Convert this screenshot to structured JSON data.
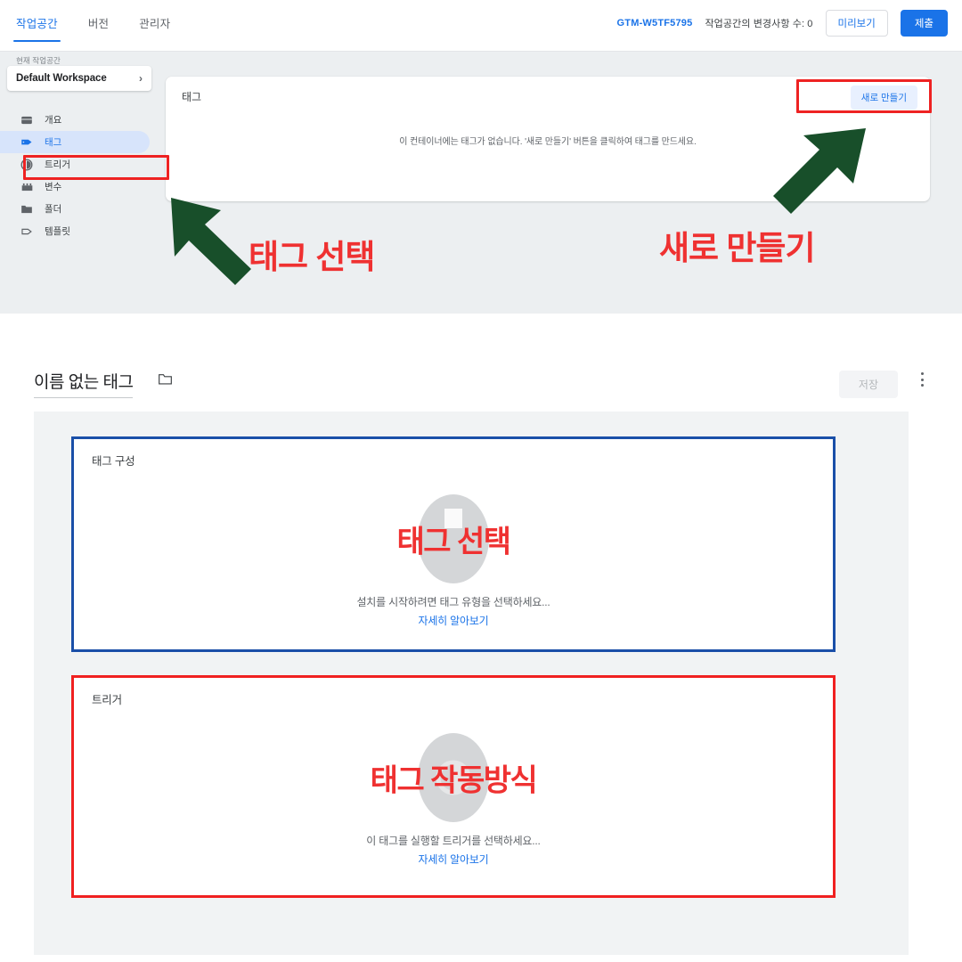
{
  "topbar": {
    "tabs": [
      {
        "label": "작업공간",
        "active": true
      },
      {
        "label": "버전",
        "active": false
      },
      {
        "label": "관리자",
        "active": false
      }
    ],
    "container_id": "GTM-W5TF5795",
    "changes_count_label": "작업공간의 변경사항 수: 0",
    "preview_label": "미리보기",
    "submit_label": "제출",
    "accent_color": "#1a73e8"
  },
  "sidebar": {
    "current_workspace_label": "현재 작업공간",
    "workspace_name": "Default Workspace",
    "chevron": "›",
    "items": [
      {
        "label": "개요",
        "icon": "overview-icon",
        "active": false
      },
      {
        "label": "태그",
        "icon": "tag-icon",
        "active": true
      },
      {
        "label": "트리거",
        "icon": "trigger-icon",
        "active": false
      },
      {
        "label": "변수",
        "icon": "variable-icon",
        "active": false
      },
      {
        "label": "폴더",
        "icon": "folder-icon",
        "active": false
      },
      {
        "label": "템플릿",
        "icon": "template-icon",
        "active": false
      }
    ]
  },
  "tags_panel": {
    "title": "태그",
    "new_button_label": "새로 만들기",
    "empty_message": "이 컨테이너에는 태그가 없습니다. '새로 만들기' 버튼을 클릭하여 태그를 만드세요."
  },
  "annotations": {
    "select_tag": "태그 선택",
    "create_new": "새로 만들기",
    "highlight_color": "#ee2222",
    "arrow_color": "#184f2a",
    "text_color": "#ef3131"
  },
  "editor": {
    "tag_name": "이름 없는 태그",
    "folder_icon": "folder-outline-icon",
    "save_label": "저장",
    "menu_icon": "kebab-menu-icon",
    "tag_config": {
      "title": "태그 구성",
      "overlay_text": "태그 선택",
      "hint": "설치를 시작하려면 태그 유형을 선택하세요...",
      "link": "자세히 알아보기",
      "border_color": "#1a4fa8"
    },
    "trigger": {
      "title": "트리거",
      "overlay_text": "태그 작동방식",
      "hint": "이 태그를 실행할 트리거를 선택하세요...",
      "link": "자세히 알아보기",
      "border_color": "#f02020"
    }
  }
}
